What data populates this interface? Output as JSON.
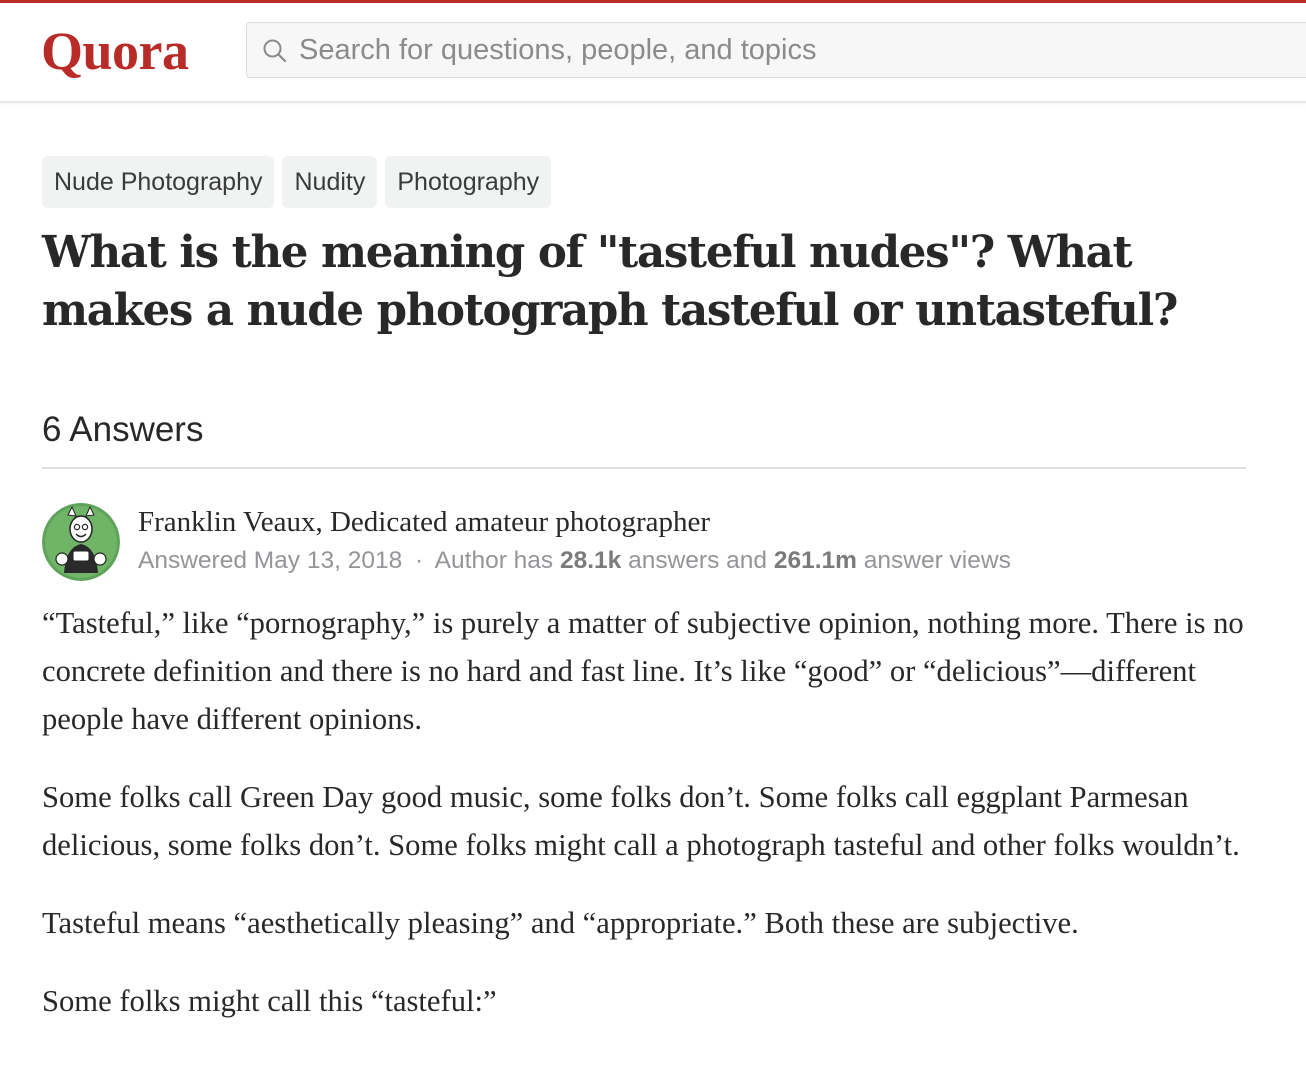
{
  "header": {
    "logo": "Quora",
    "search_placeholder": "Search for questions, people, and topics"
  },
  "topics": [
    "Nude Photography",
    "Nudity",
    "Photography"
  ],
  "question": {
    "title": "What is the meaning of \"tasteful nudes\"? What makes a nude photograph tasteful or untasteful?"
  },
  "answers": {
    "count_label": "6 Answers"
  },
  "answer": {
    "author_line": "Franklin Veaux, Dedicated amateur photographer",
    "answered_date": "Answered May 13, 2018",
    "separator": "·",
    "author_has": "Author has",
    "answers_count": "28.1k",
    "answers_and": "answers and",
    "views_count": "261.1m",
    "views_suffix": "answer views",
    "paragraphs": [
      "“Tasteful,” like “pornography,” is purely a matter of subjective opinion, nothing more. There is no concrete definition and there is no hard and fast line. It’s like “good” or “delicious”—different people have different opinions.",
      "Some folks call Green Day good music, some folks don’t. Some folks call eggplant Parmesan delicious, some folks don’t. Some folks might call a photograph tasteful and other folks wouldn’t.",
      "Tasteful means “aesthetically pleasing” and “appropriate.” Both these are subjective.",
      "Some folks might call this “tasteful:”"
    ]
  },
  "colors": {
    "brand": "#b92b27",
    "text": "#282829",
    "meta": "#939598",
    "chip_bg": "#f1f2f2",
    "search_bg": "#f7f7f8",
    "avatar_bg": "#5fa35a"
  },
  "icons": {
    "search": "search-icon",
    "avatar": "author-avatar"
  }
}
